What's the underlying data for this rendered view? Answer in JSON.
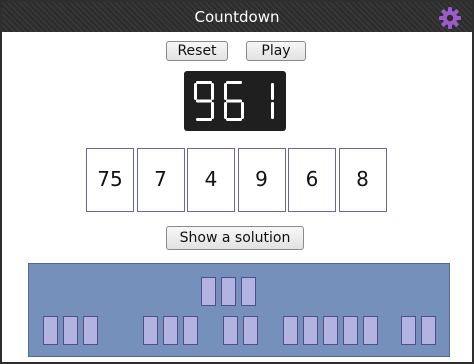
{
  "app": {
    "title": "Countdown"
  },
  "controls": {
    "reset_label": "Reset",
    "play_label": "Play",
    "solution_label": "Show a solution"
  },
  "target": {
    "value": "961",
    "display_color": "#ffffff"
  },
  "tiles": [
    "75",
    "7",
    "4",
    "9",
    "6",
    "8"
  ],
  "deck": {
    "large_cards": 3,
    "small_card_groups": [
      3,
      3,
      2,
      5,
      2
    ]
  },
  "icons": {
    "settings": "gear-icon"
  },
  "colors": {
    "titlebar": "#2b2b2b",
    "gear": "#9b5cc9",
    "tile_border": "#6a66a4",
    "deck_background": "#7591bb",
    "card_fill": "#b3b3e1"
  }
}
